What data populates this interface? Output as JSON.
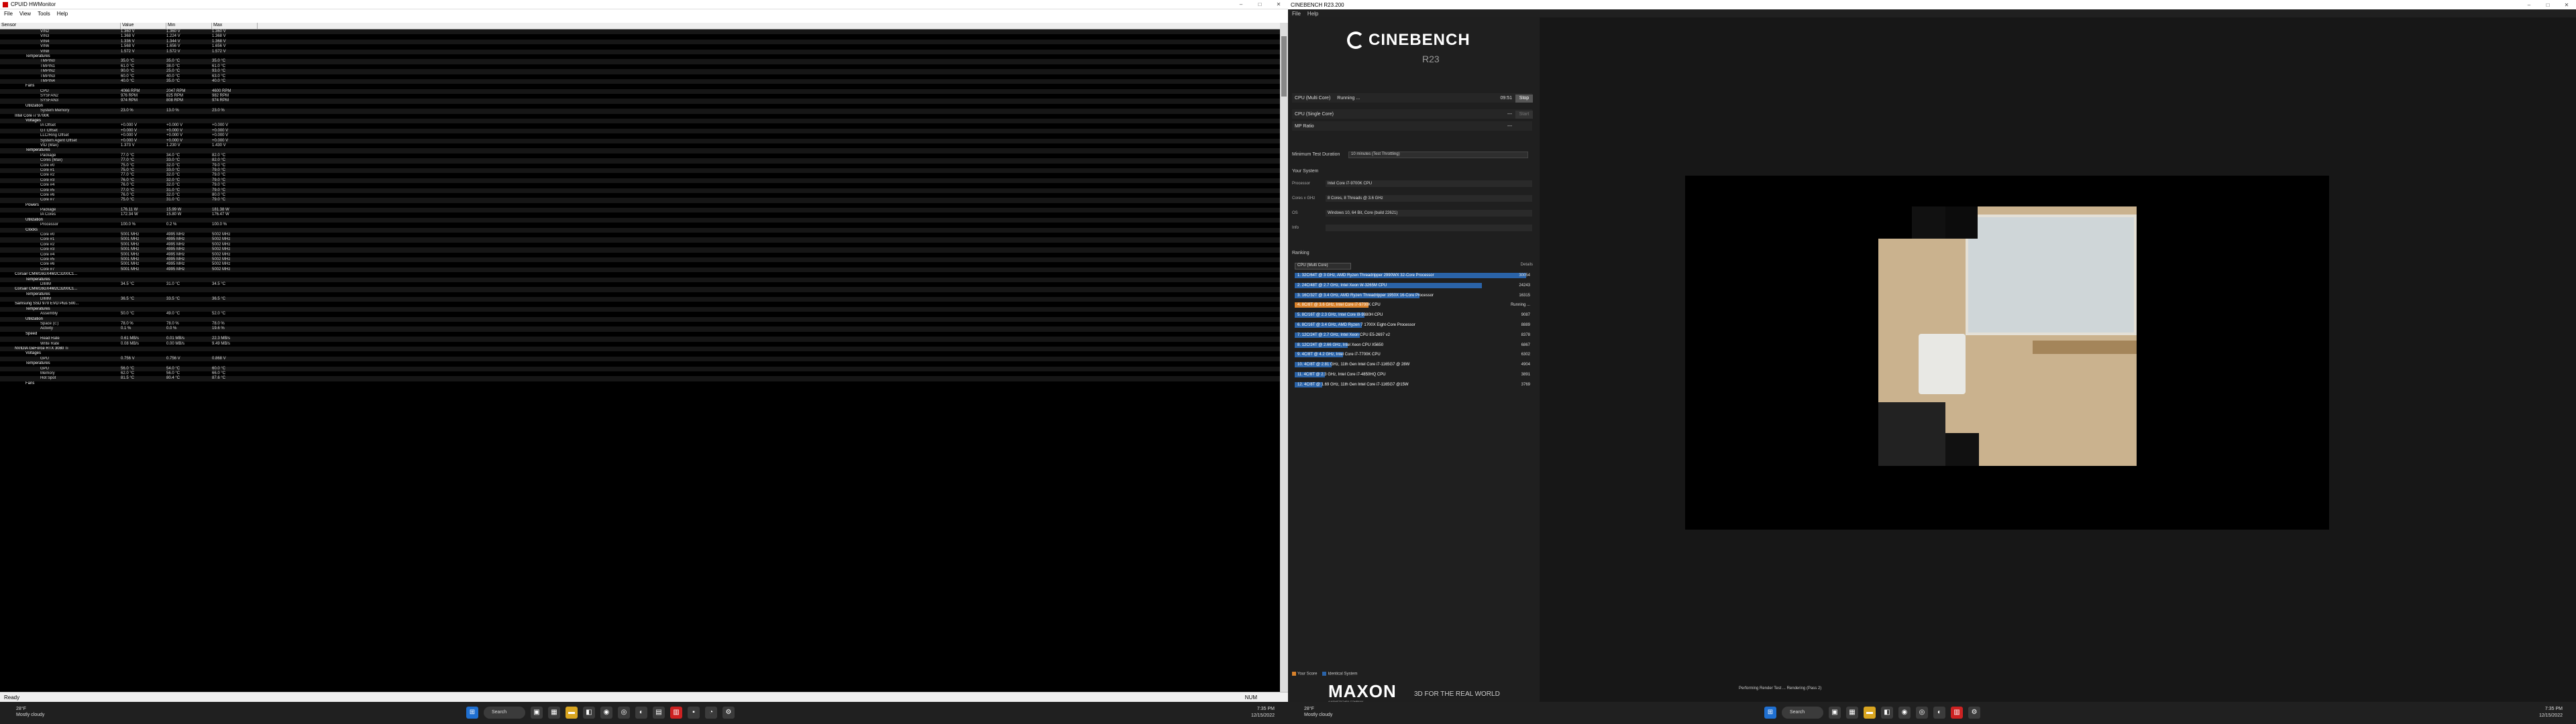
{
  "hwinfo": {
    "title": "CPUID HWMonitor",
    "menu": [
      "File",
      "View",
      "Tools",
      "Help"
    ],
    "columns": [
      "Sensor",
      "Value",
      "Min",
      "Max"
    ],
    "rows": [
      [
        "VIN2",
        "1.360 V",
        "1.360 V",
        "1.360 V"
      ],
      [
        "VIN3",
        "1.368 V",
        "1.224 V",
        "1.368 V"
      ],
      [
        "VIN4",
        "1.336 V",
        "1.344 V",
        "1.368 V"
      ],
      [
        "VIN6",
        "1.568 V",
        "1.656 V",
        "1.656 V"
      ],
      [
        "VIN8",
        "1.572 V",
        "1.572 V",
        "1.572 V"
      ],
      [
        "Temperatures",
        "",
        "",
        ""
      ],
      [
        "TMPIN0",
        "35.0 °C",
        "35.0 °C",
        "35.0 °C"
      ],
      [
        "TMPIN1",
        "61.0 °C",
        "38.0 °C",
        "61.0 °C"
      ],
      [
        "TMPIN2",
        "90.0 °C",
        "25.0 °C",
        "93.0 °C"
      ],
      [
        "TMPIN3",
        "60.0 °C",
        "40.0 °C",
        "63.0 °C"
      ],
      [
        "TMPIN4",
        "40.0 °C",
        "35.0 °C",
        "40.0 °C"
      ],
      [
        "Fans",
        "",
        "",
        ""
      ],
      [
        "CPU",
        "4066 RPM",
        "2047 RPM",
        "4600 RPM"
      ],
      [
        "SYSFAN2",
        "976 RPM",
        "825 RPM",
        "982 RPM"
      ],
      [
        "SYSFAN3",
        "974 RPM",
        "808 RPM",
        "974 RPM"
      ],
      [
        "Utilization",
        "",
        "",
        ""
      ],
      [
        "System Memory",
        "23.0 %",
        "13.0 %",
        "23.0 %"
      ],
      [
        "Intel Core i7 9700K",
        "",
        "",
        ""
      ],
      [
        "Voltages",
        "",
        "",
        ""
      ],
      [
        "IA Offset",
        "+0.000 V",
        "+0.000 V",
        "+0.000 V"
      ],
      [
        "GT Offset",
        "+0.000 V",
        "+0.000 V",
        "+0.000 V"
      ],
      [
        "LLC/Ring Offset",
        "+0.000 V",
        "+0.000 V",
        "+0.000 V"
      ],
      [
        "System Agent Offset",
        "+0.000 V",
        "+0.000 V",
        "+0.000 V"
      ],
      [
        "VID (Max)",
        "1.373 V",
        "1.230 V",
        "1.430 V"
      ],
      [
        "Temperatures",
        "",
        "",
        ""
      ],
      [
        "Package",
        "77.0 °C",
        "34.0 °C",
        "82.0 °C"
      ],
      [
        "Cores (Max)",
        "77.0 °C",
        "33.0 °C",
        "82.0 °C"
      ],
      [
        "Core #0",
        "75.0 °C",
        "32.0 °C",
        "79.0 °C"
      ],
      [
        "Core #1",
        "75.0 °C",
        "33.0 °C",
        "79.0 °C"
      ],
      [
        "Core #2",
        "77.0 °C",
        "32.0 °C",
        "79.0 °C"
      ],
      [
        "Core #3",
        "76.0 °C",
        "32.0 °C",
        "79.0 °C"
      ],
      [
        "Core #4",
        "76.0 °C",
        "32.0 °C",
        "79.0 °C"
      ],
      [
        "Core #5",
        "77.0 °C",
        "31.0 °C",
        "79.0 °C"
      ],
      [
        "Core #6",
        "76.0 °C",
        "32.0 °C",
        "80.0 °C"
      ],
      [
        "Core #7",
        "75.0 °C",
        "31.0 °C",
        "79.0 °C"
      ],
      [
        "Powers",
        "",
        "",
        ""
      ],
      [
        "Package",
        "176.11 W",
        "15.99 W",
        "181.38 W"
      ],
      [
        "IA Cores",
        "172.34 W",
        "15.80 W",
        "176.47 W"
      ],
      [
        "Utilization",
        "",
        "",
        ""
      ],
      [
        "Processor",
        "100.0 %",
        "0.2 %",
        "100.0 %"
      ],
      [
        "Clocks",
        "",
        "",
        ""
      ],
      [
        "Core #0",
        "5001 MHz",
        "4995 MHz",
        "5002 MHz"
      ],
      [
        "Core #1",
        "5001 MHz",
        "4995 MHz",
        "5002 MHz"
      ],
      [
        "Core #2",
        "5001 MHz",
        "4995 MHz",
        "5002 MHz"
      ],
      [
        "Core #3",
        "5001 MHz",
        "4995 MHz",
        "5002 MHz"
      ],
      [
        "Core #4",
        "5001 MHz",
        "4995 MHz",
        "5002 MHz"
      ],
      [
        "Core #5",
        "5001 MHz",
        "4995 MHz",
        "5002 MHz"
      ],
      [
        "Core #6",
        "5001 MHz",
        "4995 MHz",
        "5002 MHz"
      ],
      [
        "Core #7",
        "5001 MHz",
        "4995 MHz",
        "5002 MHz"
      ],
      [
        "Corsair CMW16GX4M2C3200C1...",
        "",
        "",
        ""
      ],
      [
        "Temperatures",
        "",
        "",
        ""
      ],
      [
        "DIMM",
        "34.5 °C",
        "31.0 °C",
        "34.5 °C"
      ],
      [
        "Corsair CMW16GX4M2C3200C1...",
        "",
        "",
        ""
      ],
      [
        "Temperatures",
        "",
        "",
        ""
      ],
      [
        "DIMM",
        "36.5 °C",
        "33.5 °C",
        "36.5 °C"
      ],
      [
        "Samsung SSD 970 EVO Plus 500...",
        "",
        "",
        ""
      ],
      [
        "Temperatures",
        "",
        "",
        ""
      ],
      [
        "Assembly",
        "50.0 °C",
        "49.0 °C",
        "52.0 °C"
      ],
      [
        "Utilization",
        "",
        "",
        ""
      ],
      [
        "Space (c:)",
        "78.0 %",
        "78.0 %",
        "78.0 %"
      ],
      [
        "Activity",
        "0.1 %",
        "0.0 %",
        "19.6 %"
      ],
      [
        "Speed",
        "",
        "",
        ""
      ],
      [
        "Read Rate",
        "0.61 MB/s",
        "0.01 MB/s",
        "22.3 MB/s"
      ],
      [
        "Write Rate",
        "0.08 MB/s",
        "0.00 MB/s",
        "9.49 MB/s"
      ],
      [
        "NVIDIA GeForce RTX 3080 Ti",
        "",
        "",
        ""
      ],
      [
        "Voltages",
        "",
        "",
        ""
      ],
      [
        "GPU",
        "0.756 V",
        "0.756 V",
        "0.868 V"
      ],
      [
        "Temperatures",
        "",
        "",
        ""
      ],
      [
        "GPU",
        "56.0 °C",
        "54.0 °C",
        "60.0 °C"
      ],
      [
        "Memory",
        "62.0 °C",
        "56.0 °C",
        "66.0 °C"
      ],
      [
        "Hot Spot",
        "81.5 °C",
        "80.4 °C",
        "87.6 °C"
      ],
      [
        "Fans",
        "",
        "",
        ""
      ]
    ],
    "status": "Ready",
    "status_right": "NUM"
  },
  "cinebench": {
    "title": "CINEBENCH R23.200",
    "menu": [
      "File",
      "Help"
    ],
    "logo": "CINEBENCH",
    "version": "R23",
    "tests": [
      {
        "name": "CPU (Multi Core)",
        "status": "Running ...",
        "time": "09:51",
        "button": "Stop"
      },
      {
        "name": "CPU (Single Core)",
        "status": "---",
        "button": "Start"
      },
      {
        "name": "MP Ratio",
        "status": "---"
      }
    ],
    "min_duration_label": "Minimum Test Duration",
    "min_duration_value": "10 minutes (Test Throttling)",
    "your_system": "Your System",
    "system": [
      {
        "k": "Processor",
        "v": "Intel Core i7-9700K CPU"
      },
      {
        "k": "Cores x GHz",
        "v": "8 Cores, 8 Threads @ 3.6 GHz"
      },
      {
        "k": "OS",
        "v": "Windows 10, 64 Bit, Core (build 22621)"
      },
      {
        "k": "Info",
        "v": ""
      }
    ],
    "ranking": "Ranking",
    "ranking_select": "CPU (Multi Core)",
    "details": "Details",
    "ranks": [
      {
        "l": "1. 32C/64T @ 3 GHz, AMD Ryzen Threadripper 2990WX 32-Core Processor",
        "s": "30054",
        "f": 1.0,
        "cur": false
      },
      {
        "l": "2. 24C/48T @ 2.7 GHz, Intel Xeon W-3265M CPU",
        "s": "24243",
        "f": 0.81,
        "cur": false
      },
      {
        "l": "3. 16C/32T @ 3.4 GHz, AMD Ryzen Threadripper 1950X 16-Core Processor",
        "s": "16315",
        "f": 0.54,
        "cur": false
      },
      {
        "l": "4. 8C/8T @ 3.6 GHz, Intel Core i7-9700K CPU",
        "s": "Running ...",
        "f": 0.32,
        "cur": true
      },
      {
        "l": "5. 8C/16T @ 2.3 GHz, Intel Core i9-9880H CPU",
        "s": "9087",
        "f": 0.3,
        "cur": false
      },
      {
        "l": "6. 8C/16T @ 3.4 GHz, AMD Ryzen 7 1700X Eight-Core Processor",
        "s": "8889",
        "f": 0.29,
        "cur": false
      },
      {
        "l": "7. 12C/24T @ 2.7 GHz, Intel Xeon CPU E5-2697 v2",
        "s": "8378",
        "f": 0.28,
        "cur": false
      },
      {
        "l": "8. 12C/24T @ 2.66 GHz, Intel Xeon CPU X5650",
        "s": "6867",
        "f": 0.23,
        "cur": false
      },
      {
        "l": "9. 4C/8T @ 4.2 GHz, Intel Core i7-7700K CPU",
        "s": "6302",
        "f": 0.21,
        "cur": false
      },
      {
        "l": "10. 4C/8T @ 2.81 GHz, 11th Gen Intel Core i7-1165G7 @ 28W",
        "s": "4904",
        "f": 0.16,
        "cur": false
      },
      {
        "l": "11. 4C/8T @ 2.3 GHz, Intel Core i7-4850HQ CPU",
        "s": "3891",
        "f": 0.13,
        "cur": false
      },
      {
        "l": "12. 4C/8T @ 1.69 GHz, 11th Gen Intel Core i7-1165G7 @15W",
        "s": "3769",
        "f": 0.12,
        "cur": false
      }
    ],
    "legend_your": "Your Score",
    "legend_identical": "Identical System",
    "maxon": "MAXON",
    "maxon_sub": "A NEMETSCHEK COMPANY",
    "maxon_tag": "3D FOR THE REAL WORLD",
    "status": "Performing Render Test ... Rendering (Pass 2)"
  },
  "taskbar": {
    "temp": "28°F",
    "weather": "Mostly cloudy",
    "search": "Search",
    "time": "7:35 PM",
    "date": "12/15/2022"
  }
}
